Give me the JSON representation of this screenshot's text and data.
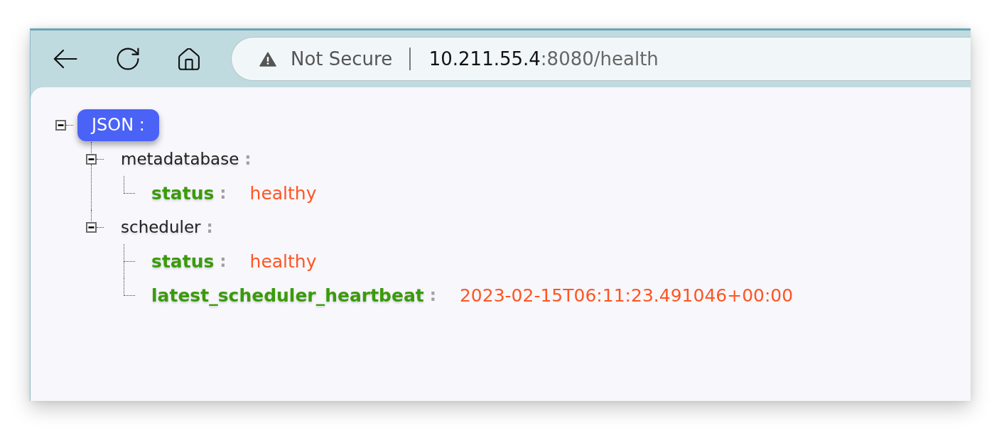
{
  "address_bar": {
    "security_label": "Not Secure",
    "host": "10.211.55.4",
    "path": ":8080/health"
  },
  "tree": {
    "label": "JSON",
    "colon": ":",
    "expanded": true,
    "children": [
      {
        "kind": "object",
        "key": "metadatabase",
        "colon": ":",
        "expanded": true,
        "children": [
          {
            "kind": "value",
            "key": "status",
            "colon": ":",
            "value": "healthy"
          }
        ]
      },
      {
        "kind": "object",
        "key": "scheduler",
        "colon": ":",
        "expanded": true,
        "children": [
          {
            "kind": "value",
            "key": "status",
            "colon": ":",
            "value": "healthy"
          },
          {
            "kind": "value",
            "key": "latest_scheduler_heartbeat",
            "colon": ":",
            "value": "2023-02-15T06:11:23.491046+00:00"
          }
        ]
      }
    ]
  }
}
